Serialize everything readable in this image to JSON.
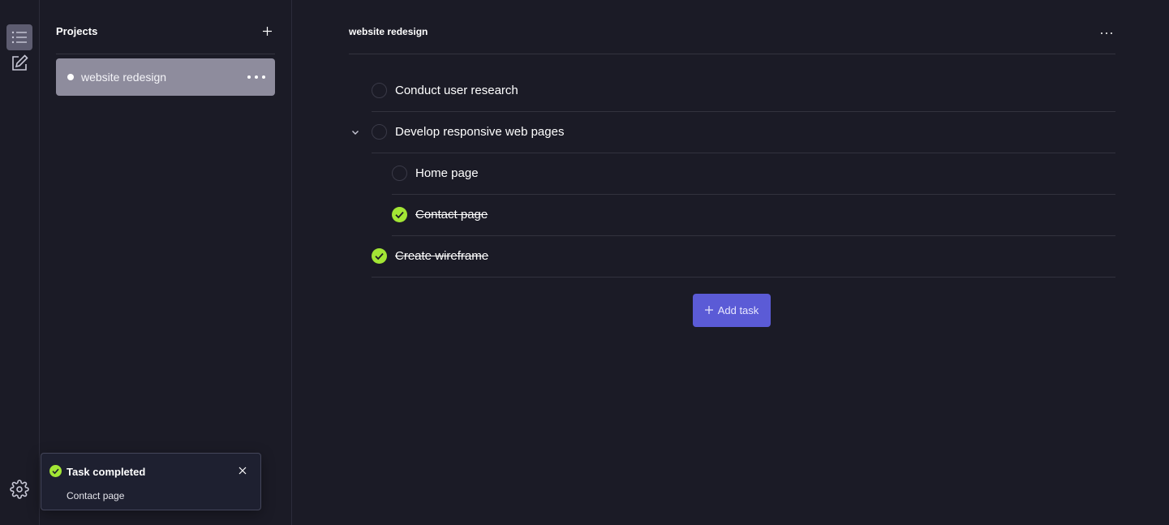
{
  "rail": {
    "items": [
      {
        "icon": "list-icon",
        "active": true
      },
      {
        "icon": "edit-icon",
        "active": false
      }
    ],
    "settings_icon": "gear-icon"
  },
  "projects": {
    "title": "Projects",
    "add_icon": "plus-icon",
    "items": [
      {
        "name": "website redesign",
        "selected": true
      }
    ]
  },
  "main": {
    "title": "website redesign",
    "tasks": [
      {
        "label": "Conduct user research",
        "done": false,
        "level": 0
      },
      {
        "label": "Develop responsive web pages",
        "done": false,
        "level": 0,
        "expanded": true
      },
      {
        "label": "Home page",
        "done": false,
        "level": 1
      },
      {
        "label": "Contact page",
        "done": true,
        "level": 1
      },
      {
        "label": "Create wireframe",
        "done": true,
        "level": 0
      }
    ],
    "add_task_label": "Add task"
  },
  "toast": {
    "title": "Task completed",
    "body": "Contact page"
  },
  "colors": {
    "background": "#1b1b26",
    "accent": "#5b5bd6",
    "done_green": "#a3e635",
    "selected_project": "#8e8c9d"
  }
}
